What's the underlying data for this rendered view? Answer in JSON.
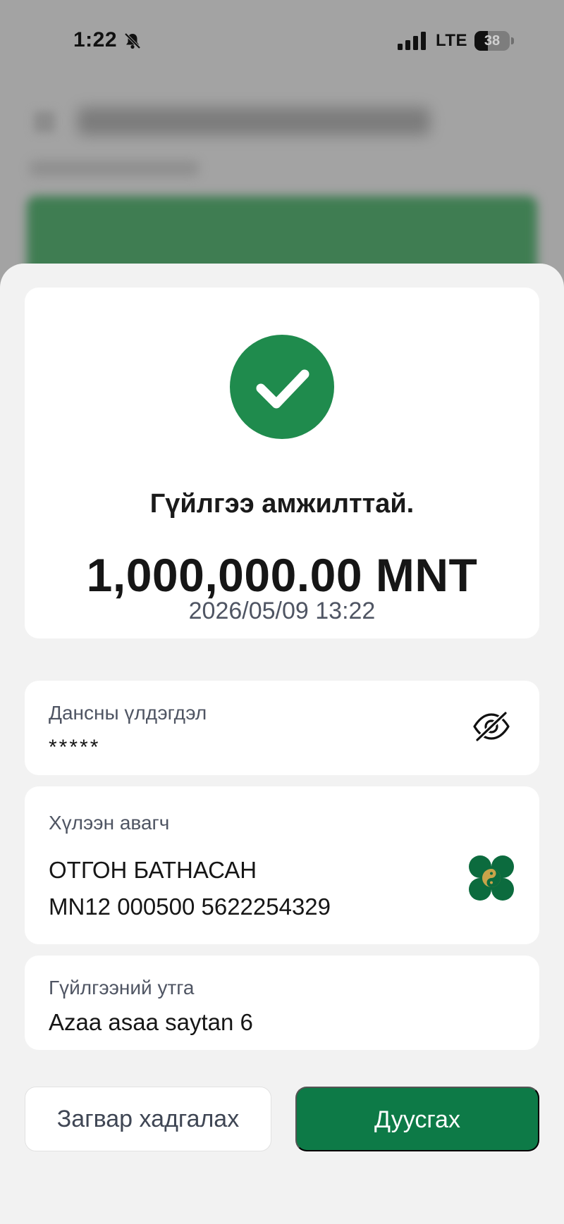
{
  "status_bar": {
    "time": "1:22",
    "network": "LTE",
    "battery": "38",
    "battery_level": 0.38
  },
  "receipt": {
    "status_title": "Гүйлгээ амжилттай.",
    "amount": "1,000,000.00 MNT",
    "datetime": "2026/05/09 13:22"
  },
  "balance": {
    "label": "Дансны үлдэгдэл",
    "value": "*****"
  },
  "recipient": {
    "label": "Хүлээн авагч",
    "name": "ОТГОН БАТНАСАН",
    "account": "MN12 000500 5622254329"
  },
  "description": {
    "label": "Гүйлгээний утга",
    "value": "Azaa asaa saytan 6"
  },
  "actions": {
    "save_template": "Загвар хадгалах",
    "finish": "Дуусгах"
  },
  "colors": {
    "success": "#1f8b4d",
    "primary_button": "#0d7a47",
    "bank_logo": "#0c6b3e"
  },
  "icons": [
    "bell-slash-icon",
    "signal-icon",
    "battery-icon",
    "check-icon",
    "eye-off-icon",
    "bank-logo-icon"
  ]
}
